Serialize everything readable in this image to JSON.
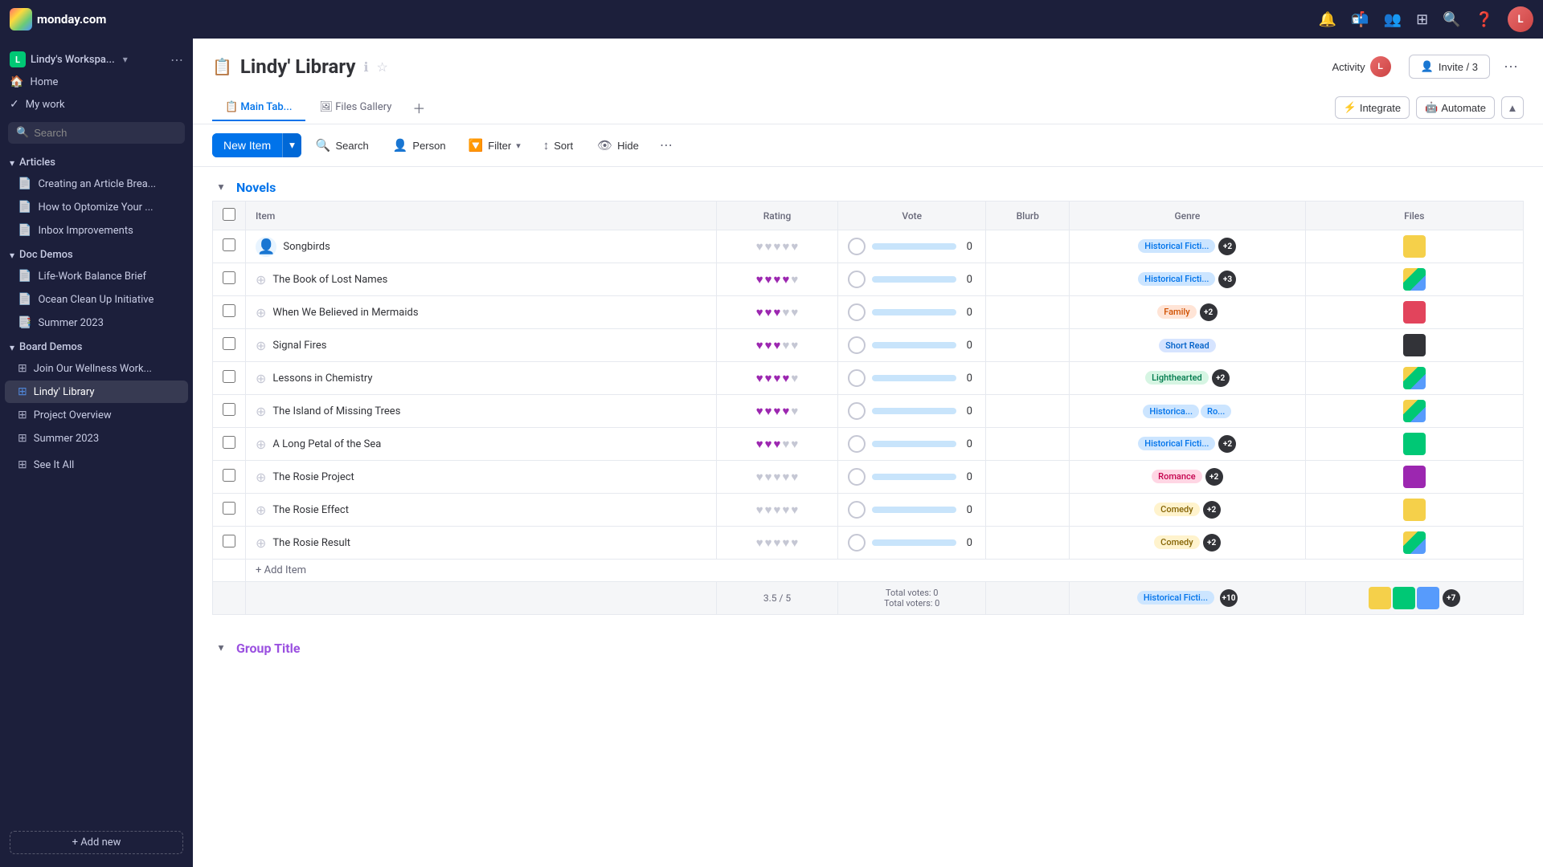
{
  "app": {
    "name": "monday.com"
  },
  "topnav": {
    "notifications_icon": "🔔",
    "inbox_icon": "📬",
    "people_icon": "👥",
    "search_icon": "🔍",
    "help_icon": "❓",
    "user_initials": "L"
  },
  "sidebar": {
    "workspace_name": "Lindy's Workspa...",
    "search_placeholder": "Search",
    "home_label": "Home",
    "mywork_label": "My work",
    "articles_label": "Articles",
    "articles_items": [
      {
        "label": "Creating an Article Brea...",
        "icon": "📄"
      },
      {
        "label": "How to Optomize Your ...",
        "icon": "📄"
      },
      {
        "label": "Inbox Improvements",
        "icon": "📄"
      }
    ],
    "doc_demos_label": "Doc Demos",
    "doc_demos_items": [
      {
        "label": "Life-Work Balance Brief",
        "icon": "📄"
      },
      {
        "label": "Ocean Clean Up Initiative",
        "icon": "📄"
      },
      {
        "label": "Summer 2023",
        "icon": "📑"
      }
    ],
    "board_demos_label": "Board Demos",
    "board_demos_items": [
      {
        "label": "Join Our Wellness Work...",
        "icon": "⊞"
      },
      {
        "label": "Lindy' Library",
        "icon": "⊞",
        "active": true
      },
      {
        "label": "Project Overview",
        "icon": "⊞"
      },
      {
        "label": "Summer 2023",
        "icon": "⊞"
      }
    ],
    "see_it_all_label": "See It All",
    "add_new_label": "+ Add new"
  },
  "board": {
    "title": "Lindy' Library",
    "title_icon": "📋",
    "activity_label": "Activity",
    "invite_label": "Invite / 3",
    "tabs": [
      {
        "label": "Main Tab...",
        "active": true
      },
      {
        "label": "Files Gallery"
      }
    ],
    "integrate_label": "Integrate",
    "automate_label": "Automate"
  },
  "toolbar": {
    "new_item_label": "New Item",
    "search_label": "Search",
    "person_label": "Person",
    "filter_label": "Filter",
    "sort_label": "Sort",
    "hide_label": "Hide"
  },
  "novels_group": {
    "title": "Novels",
    "columns": [
      "Item",
      "Rating",
      "Vote",
      "Blurb",
      "Genre",
      "Files"
    ],
    "rows": [
      {
        "item": "Songbirds",
        "person_active": true,
        "rating": 0,
        "vote_count": 0,
        "genre": "Historical Ficti...",
        "genre_type": "historical",
        "genre_extra": "+2",
        "file_color": "yellow"
      },
      {
        "item": "The Book of Lost Names",
        "rating": 4,
        "vote_count": 0,
        "genre": "Historical Ficti...",
        "genre_type": "historical",
        "genre_extra": "+3",
        "file_color": "multi"
      },
      {
        "item": "When We Believed in Mermaids",
        "rating": 3,
        "vote_count": 0,
        "genre": "Family",
        "genre_type": "family",
        "genre_extra": "+2",
        "file_color": "red"
      },
      {
        "item": "Signal Fires",
        "rating": 3,
        "vote_count": 0,
        "genre": "Short Read",
        "genre_type": "short",
        "genre_extra": "",
        "file_color": "dark"
      },
      {
        "item": "Lessons in Chemistry",
        "rating": 4,
        "vote_count": 0,
        "genre": "Lighthearted",
        "genre_type": "lighthearted",
        "genre_extra": "+2",
        "file_color": "multi"
      },
      {
        "item": "The Island of Missing Trees",
        "rating": 4,
        "vote_count": 0,
        "genre": "Historica...",
        "genre_type": "historical",
        "genre_extra2": "Ro...",
        "file_color": "multi"
      },
      {
        "item": "A Long Petal of the Sea",
        "rating": 3,
        "vote_count": 0,
        "genre": "Historical Ficti...",
        "genre_type": "historical",
        "genre_extra": "+2",
        "file_color": "green"
      },
      {
        "item": "The Rosie Project",
        "rating": 0,
        "vote_count": 0,
        "genre": "Romance",
        "genre_type": "romance",
        "genre_extra": "+2",
        "file_color": "purple"
      },
      {
        "item": "The Rosie Effect",
        "rating": 0,
        "vote_count": 0,
        "genre": "Comedy",
        "genre_type": "comedy",
        "genre_extra": "+2",
        "file_color": "yellow"
      },
      {
        "item": "The Rosie Result",
        "rating": 0,
        "vote_count": 0,
        "genre": "Comedy",
        "genre_type": "comedy",
        "genre_extra": "+2",
        "file_color": "multi"
      }
    ],
    "add_item_label": "+ Add Item",
    "summary_rating": "3.5 / 5",
    "summary_total_votes": "Total votes: 0",
    "summary_total_voters": "Total voters: 0",
    "summary_genre": "Historical Ficti...",
    "summary_genre_extra": "+10",
    "summary_files_extra": "+7"
  },
  "group2": {
    "title": "Group Title"
  }
}
